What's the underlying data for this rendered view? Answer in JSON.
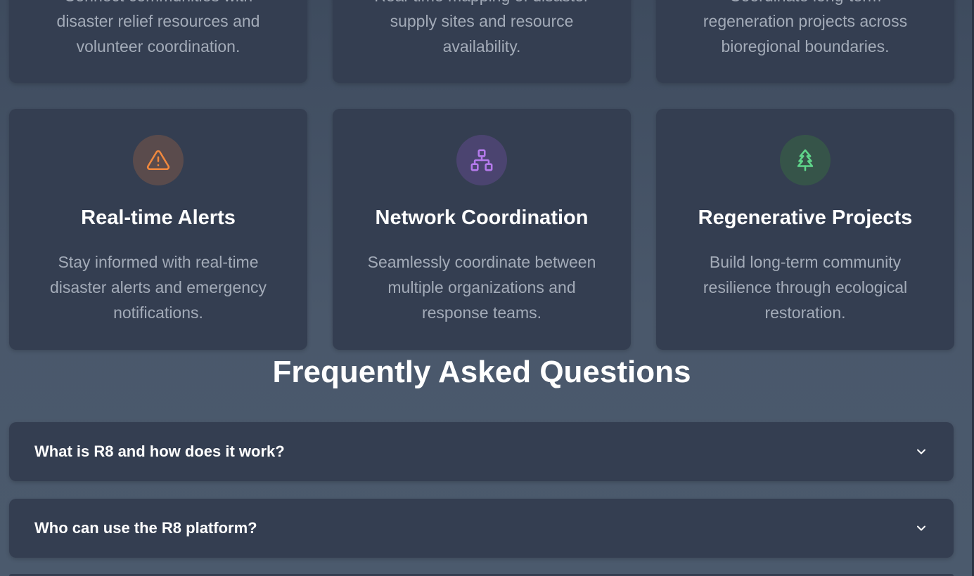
{
  "top_cards": [
    {
      "desc": "Connect communities with disaster relief resources and volunteer coordination."
    },
    {
      "desc": "Real-time mapping of disaster supply sites and resource availability."
    },
    {
      "desc": "Coordinate long-term regeneration projects across bioregional boundaries."
    }
  ],
  "features": [
    {
      "icon": "alert-triangle-icon",
      "icon_color": "#f0883e",
      "bg_color": "#5a4b4c",
      "title": "Real-time Alerts",
      "desc": "Stay informed with real-time disaster alerts and emergency notifications."
    },
    {
      "icon": "network-icon",
      "icon_color": "#b57aec",
      "bg_color": "#4b4470",
      "title": "Network Coordination",
      "desc": "Seamlessly coordinate between multiple organizations and response teams."
    },
    {
      "icon": "tree-icon",
      "icon_color": "#5fd58a",
      "bg_color": "#365449",
      "title": "Regenerative Projects",
      "desc": "Build long-term community resilience through ecological restoration."
    }
  ],
  "faq": {
    "title": "Frequently Asked Questions",
    "items": [
      {
        "question": "What is R8 and how does it work?"
      },
      {
        "question": "Who can use the R8 platform?"
      }
    ]
  }
}
